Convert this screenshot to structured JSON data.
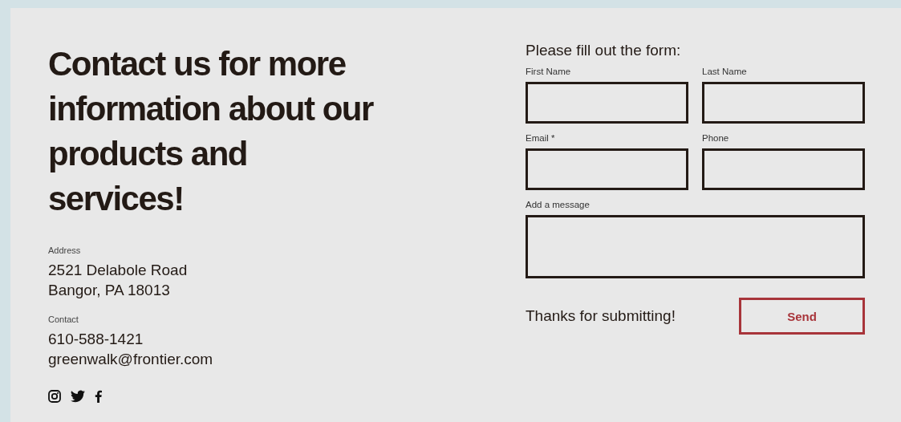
{
  "contact": {
    "heading": "Contact us for more information about our products and services!",
    "sections": [
      {
        "label": "Address",
        "lines": [
          "2521 Delabole Road",
          "Bangor, PA 18013"
        ]
      },
      {
        "label": "Contact",
        "lines": [
          "610-588-1421",
          "greenwalk@frontier.com"
        ]
      }
    ],
    "social": [
      {
        "kind": "instagram"
      },
      {
        "kind": "twitter"
      },
      {
        "kind": "facebook"
      }
    ]
  },
  "form": {
    "title": "Please fill out the form:",
    "fields": [
      {
        "label": "First Name",
        "kind": "text"
      },
      {
        "label": "Last Name",
        "kind": "text"
      },
      {
        "label": "Email *",
        "kind": "text"
      },
      {
        "label": "Phone",
        "kind": "text"
      },
      {
        "label": "Add a message",
        "kind": "textarea"
      }
    ],
    "confirmation": "Thanks for submitting!",
    "submit": "Send"
  }
}
